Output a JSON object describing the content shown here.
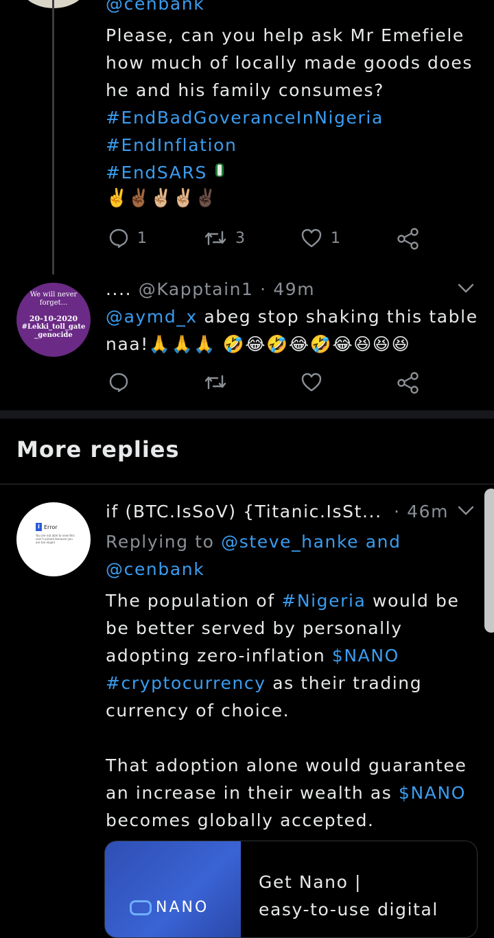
{
  "tweet1": {
    "handle_line": "@cenbank",
    "text_lines": [
      "Please, can you help ask Mr Emefiele",
      "how much of locally made goods does",
      "he and his family consumes?"
    ],
    "hashtags": [
      "#EndBadGoveranceInNigeria",
      "#EndInflation",
      "#EndSARS"
    ],
    "emoji_line": "✌️✌🏾✌🏼✌🏼✌🏿",
    "actions": {
      "reply_count": "1",
      "retweet_count": "3",
      "like_count": "1"
    }
  },
  "tweet2": {
    "avatar_text": [
      "We will never",
      "forget...",
      "20-10-2020",
      "#Lekki_toll_gate",
      "_genocide"
    ],
    "name": "....",
    "handle": "@Kapptain1",
    "separator": "·",
    "time": "49m",
    "mention": "@aymd_x",
    "text_line1": "abeg stop shaking this table",
    "text_line2": "naa!🙏🙏🙏 🤣😂🤣😂🤣😂😆😆😆"
  },
  "section_title": "More replies",
  "tweet3": {
    "avatar_error": {
      "title": "Error",
      "body": "You are not able to view this user's picture because you are too stupid"
    },
    "name": "if (BTC.IsSoV) {Titanic.IsSt...",
    "separator": "·",
    "time": "46m",
    "replying_prefix": "Replying to",
    "reply_to_1": "@steve_hanke",
    "reply_and": "and",
    "reply_to_2": "@cenbank",
    "p1_a": "The population of",
    "p1_hashtag": "#Nigeria",
    "p1_b": "would be",
    "p1_line2": "be better served by personally",
    "p1_line3a": "adopting zero-inflation",
    "p1_cashtag": "$NANO",
    "p1_hashtag2": "#cryptocurrency",
    "p1_line4b": "as their trading",
    "p1_line5": "currency of choice.",
    "p2_line1": "That adoption alone would guarantee",
    "p2_line2a": "an increase in their wealth as",
    "p2_cashtag": "$NANO",
    "p2_line3": "becomes globally accepted.",
    "card": {
      "logo": "NANO",
      "title": "Get Nano |",
      "subtitle": "easy-to-use digital"
    }
  }
}
